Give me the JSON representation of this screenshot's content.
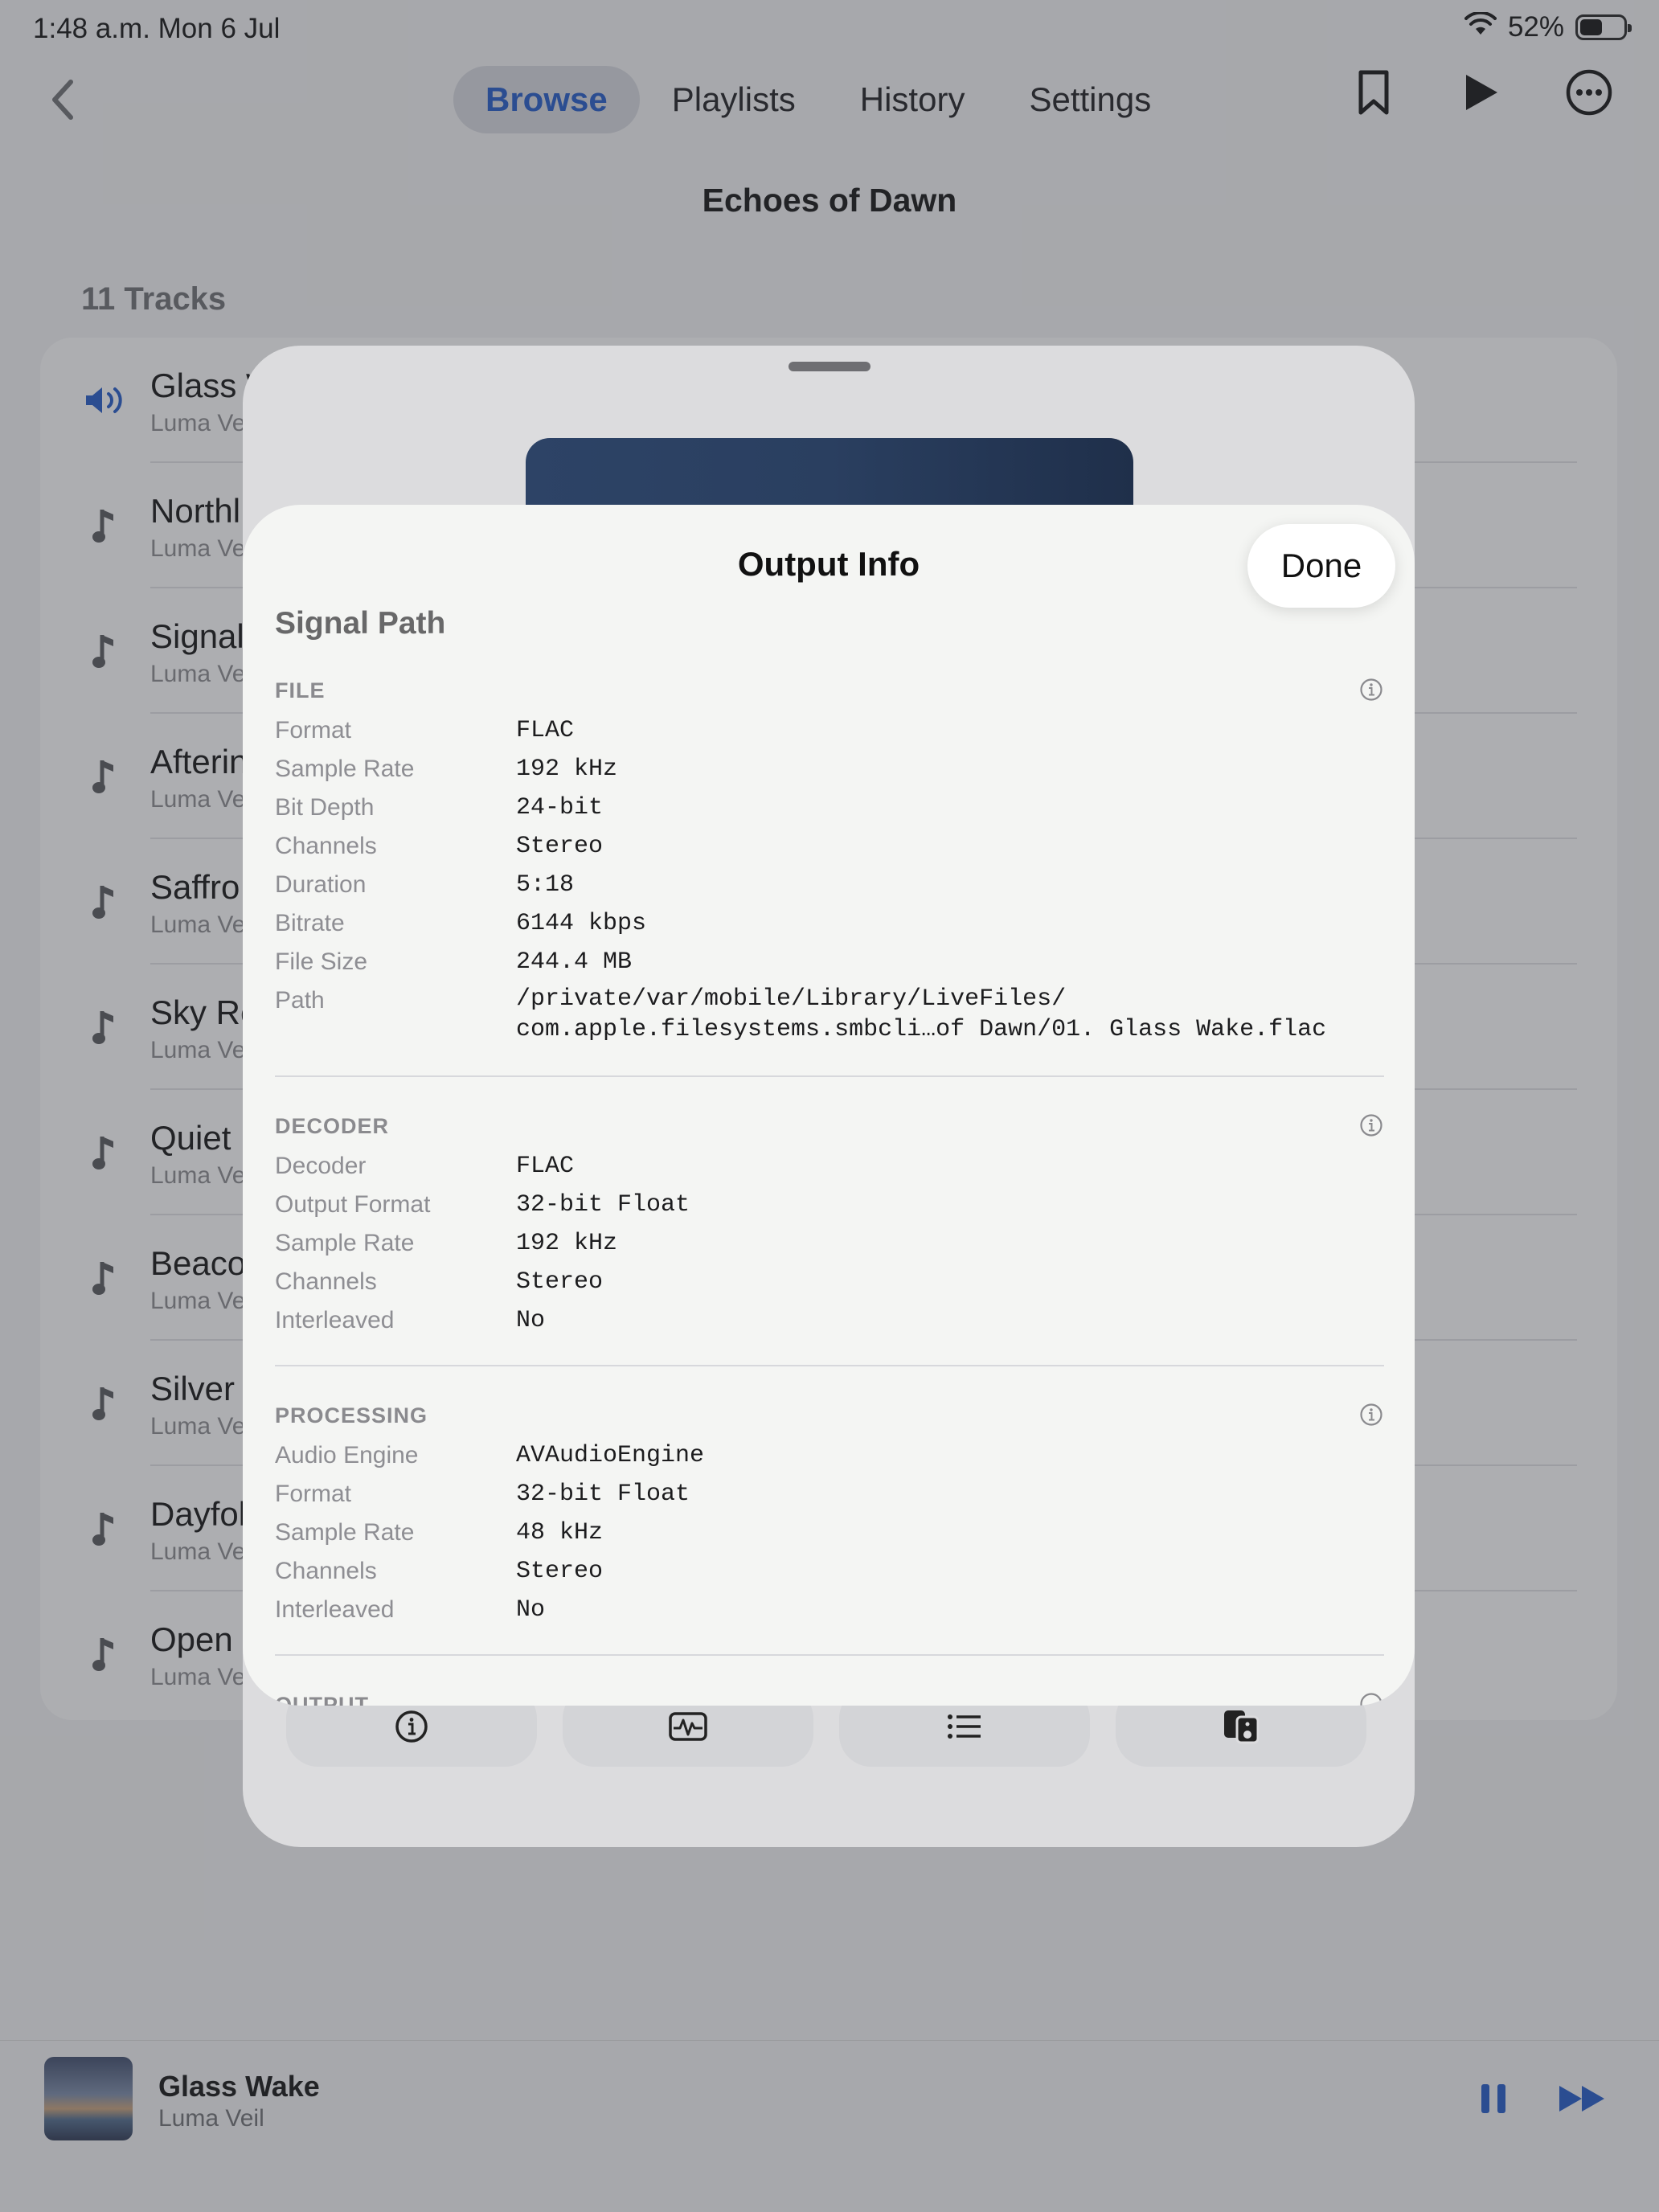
{
  "status_bar": {
    "time": "1:48 a.m.   Mon 6 Jul",
    "battery": "52%"
  },
  "nav": {
    "tabs": [
      {
        "label": "Browse",
        "active": true
      },
      {
        "label": "Playlists",
        "active": false
      },
      {
        "label": "History",
        "active": false
      },
      {
        "label": "Settings",
        "active": false
      }
    ],
    "icons": [
      "chevron-left-icon",
      "bookmark-icon",
      "play-icon",
      "more-icon"
    ]
  },
  "album": {
    "title": "Echoes of Dawn",
    "track_count": "11 Tracks"
  },
  "tracks": [
    {
      "name": "Glass W",
      "artist": "Luma Ve",
      "playing": true
    },
    {
      "name": "Northl",
      "artist": "Luma Ve"
    },
    {
      "name": "Signal",
      "artist": "Luma Ve"
    },
    {
      "name": "Afterin",
      "artist": "Luma Ve"
    },
    {
      "name": "Saffro",
      "artist": "Luma Ve"
    },
    {
      "name": "Sky Re",
      "artist": "Luma Ve"
    },
    {
      "name": "Quiet",
      "artist": "Luma Ve"
    },
    {
      "name": "Beaco",
      "artist": "Luma Ve"
    },
    {
      "name": "Silver",
      "artist": "Luma Ve"
    },
    {
      "name": "Dayfol",
      "artist": "Luma Ve"
    },
    {
      "name": "Open",
      "artist": "Luma Ve"
    }
  ],
  "now_playing": {
    "title": "Glass Wake",
    "artist": "Luma Veil"
  },
  "output_info": {
    "title": "Output Info",
    "done_label": "Done",
    "subtitle": "Signal Path",
    "sections": [
      {
        "heading": "FILE",
        "rows": [
          {
            "label": "Format",
            "value": "FLAC"
          },
          {
            "label": "Sample Rate",
            "value": "192 kHz"
          },
          {
            "label": "Bit Depth",
            "value": "24-bit"
          },
          {
            "label": "Channels",
            "value": "Stereo"
          },
          {
            "label": "Duration",
            "value": "5:18"
          },
          {
            "label": "Bitrate",
            "value": "6144 kbps"
          },
          {
            "label": "File Size",
            "value": "244.4 MB"
          },
          {
            "label": "Path",
            "value": "/private/var/mobile/Library/LiveFiles/\ncom.apple.filesystems.smbcli…of Dawn/01. Glass Wake.flac"
          }
        ]
      },
      {
        "heading": "DECODER",
        "rows": [
          {
            "label": "Decoder",
            "value": "FLAC"
          },
          {
            "label": "Output Format",
            "value": "32-bit Float"
          },
          {
            "label": "Sample Rate",
            "value": "192 kHz"
          },
          {
            "label": "Channels",
            "value": "Stereo"
          },
          {
            "label": "Interleaved",
            "value": "No"
          }
        ]
      },
      {
        "heading": "PROCESSING",
        "rows": [
          {
            "label": "Audio Engine",
            "value": "AVAudioEngine"
          },
          {
            "label": "Format",
            "value": "32-bit Float"
          },
          {
            "label": "Sample Rate",
            "value": "48 kHz"
          },
          {
            "label": "Channels",
            "value": "Stereo"
          },
          {
            "label": "Interleaved",
            "value": "No"
          }
        ]
      },
      {
        "heading": "OUTPUT",
        "rows": []
      }
    ]
  },
  "sheet_tabs": [
    "info-icon",
    "waveform-icon",
    "list-icon",
    "speaker-icon"
  ],
  "colors": {
    "accent": "#1f58c8"
  }
}
